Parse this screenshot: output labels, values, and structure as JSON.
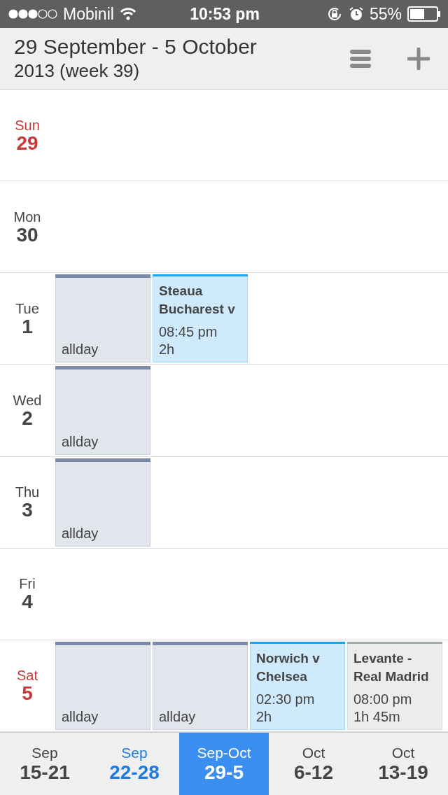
{
  "status_bar": {
    "carrier": "Mobinil",
    "time": "10:53 pm",
    "battery": "55%"
  },
  "header": {
    "title": "29 September - 5 October",
    "subtitle": "2013 (week 39)"
  },
  "days": [
    {
      "name": "Sun",
      "number": "29",
      "weekend": true
    },
    {
      "name": "Mon",
      "number": "30",
      "weekend": false
    },
    {
      "name": "Tue",
      "number": "1",
      "weekend": false,
      "events": [
        {
          "kind": "allday",
          "label": "allday",
          "color": "#7a8aa8"
        },
        {
          "kind": "timed",
          "title": "Steaua Bucharest v",
          "time": "08:45 pm",
          "duration": "2h",
          "color": "#1ea0f0"
        }
      ]
    },
    {
      "name": "Wed",
      "number": "2",
      "weekend": false,
      "events": [
        {
          "kind": "allday",
          "label": "allday",
          "color": "#7a8aa8"
        }
      ]
    },
    {
      "name": "Thu",
      "number": "3",
      "weekend": false,
      "events": [
        {
          "kind": "allday",
          "label": "allday",
          "color": "#7a8aa8"
        }
      ]
    },
    {
      "name": "Fri",
      "number": "4",
      "weekend": false
    },
    {
      "name": "Sat",
      "number": "5",
      "weekend": true,
      "events": [
        {
          "kind": "allday",
          "label": "allday",
          "color": "#7a8aa8"
        },
        {
          "kind": "allday",
          "label": "allday",
          "color": "#7a8aa8"
        },
        {
          "kind": "timed",
          "title": "Norwich v Chelsea",
          "time": "02:30 pm",
          "duration": "2h",
          "color": "#1ea0f0"
        },
        {
          "kind": "timed",
          "title": "Levante - Real Madrid",
          "time": "08:00 pm",
          "duration": "1h 45m",
          "color": "#a4ada4"
        }
      ]
    }
  ],
  "weeks": [
    {
      "month": "Sep",
      "range": "15-21",
      "selected": false,
      "current": false
    },
    {
      "month": "Sep",
      "range": "22-28",
      "selected": false,
      "current": true
    },
    {
      "month": "Sep-Oct",
      "range": "29-5",
      "selected": true,
      "current": false
    },
    {
      "month": "Oct",
      "range": "6-12",
      "selected": false,
      "current": false
    },
    {
      "month": "Oct",
      "range": "13-19",
      "selected": false,
      "current": false
    }
  ]
}
